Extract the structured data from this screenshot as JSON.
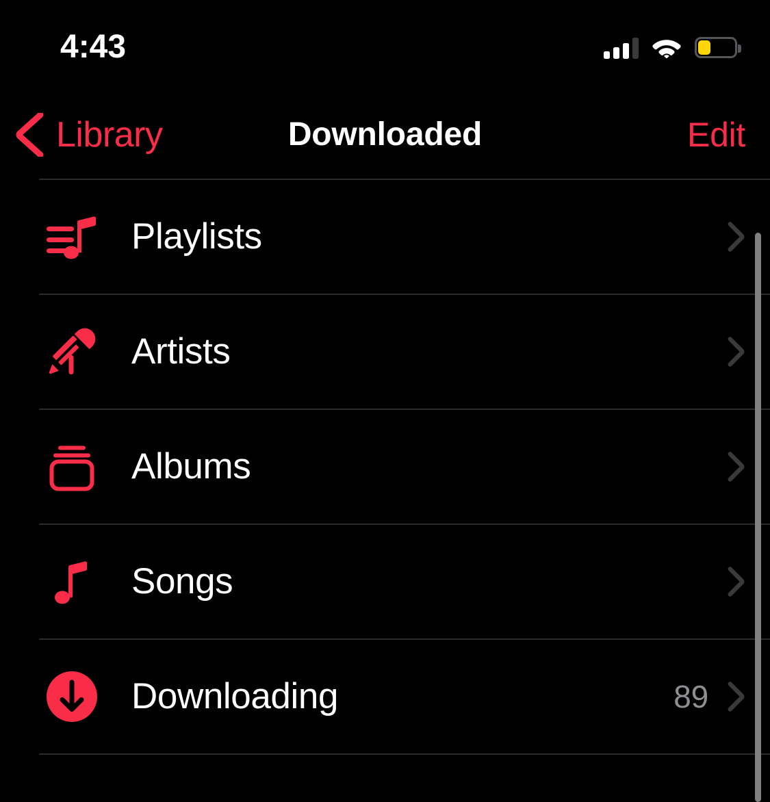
{
  "theme": {
    "background": "#000000",
    "accent": "#fa2d48",
    "primary_text": "#ffffff",
    "secondary_text": "#8e8e93",
    "separator": "#2b2b2d",
    "chevron": "#3a3a3c",
    "battery_fill": "#ffd60a"
  },
  "status_bar": {
    "time": "4:43",
    "cellular_icon": "cellular-signal-icon",
    "cellular_bars_filled": 3,
    "cellular_bars_total": 4,
    "wifi_icon": "wifi-icon",
    "wifi_strength": "full",
    "battery_icon": "battery-icon",
    "battery_level_percent": 35,
    "battery_low_power_mode": true
  },
  "nav_bar": {
    "back_icon": "chevron-left-icon",
    "back_label": "Library",
    "title": "Downloaded",
    "edit_label": "Edit"
  },
  "list": {
    "rows": [
      {
        "label": "Playlists",
        "icon": "playlists-icon",
        "count": "",
        "accessory_icon": "chevron-right-icon"
      },
      {
        "label": "Artists",
        "icon": "microphone-icon",
        "count": "",
        "accessory_icon": "chevron-right-icon"
      },
      {
        "label": "Albums",
        "icon": "albums-icon",
        "count": "",
        "accessory_icon": "chevron-right-icon"
      },
      {
        "label": "Songs",
        "icon": "music-note-icon",
        "count": "",
        "accessory_icon": "chevron-right-icon"
      },
      {
        "label": "Downloading",
        "icon": "download-circle-icon",
        "count": "89",
        "accessory_icon": "chevron-right-icon"
      }
    ]
  },
  "scrollbar": {
    "name": "vertical-scrollbar"
  }
}
